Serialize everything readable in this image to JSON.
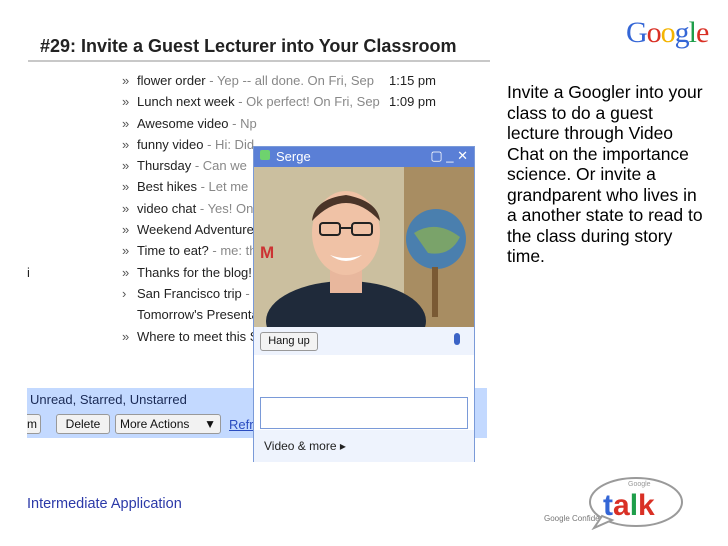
{
  "slide": {
    "title": "#29: Invite a Guest Lecturer into Your Classroom",
    "description": "Invite a Googler into your class to do a guest lecture through Video Chat on the importance science. Or invite a grandparent who lives in a another state to read to the class during story time.",
    "footer_label": "Intermediate Application",
    "confidential": "Google Confidential",
    "brand": {
      "letters": [
        "G",
        "o",
        "o",
        "g",
        "l",
        "e"
      ],
      "colors": [
        "#3466d6",
        "#d93025",
        "#f4b400",
        "#3466d6",
        "#1e9e4a",
        "#d93025"
      ]
    },
    "talk_logo": {
      "small_text": "Google",
      "word": "talk",
      "colors": [
        "#3466d6",
        "#d93025",
        "#1e9e4a",
        "#d93025"
      ]
    }
  },
  "mail": {
    "rows": [
      {
        "label": "",
        "chevron": "»",
        "subject": "flower order",
        "snippet": " - Yep -- all done. On Fri, Sep",
        "time": "1:15 pm"
      },
      {
        "label": "",
        "chevron": "»",
        "subject": "Lunch next week",
        "snippet": " - Ok perfect! On Fri, Sep",
        "time": "1:09 pm"
      },
      {
        "label": "",
        "chevron": "»",
        "subject": "Awesome video",
        "snippet": " - Np",
        "time": ""
      },
      {
        "label": "",
        "chevron": "»",
        "subject": "funny video",
        "snippet": " - Hi: Did",
        "time": ""
      },
      {
        "label": "",
        "chevron": "»",
        "subject": "Thursday",
        "snippet": " - Can we",
        "time": ""
      },
      {
        "label": "",
        "chevron": "»",
        "subject": "Best hikes",
        "snippet": " - Let me",
        "time": ""
      },
      {
        "label": "",
        "chevron": "»",
        "subject": "video chat",
        "snippet": " - Yes! On",
        "time": ""
      },
      {
        "label": "",
        "chevron": "»",
        "subject": "Weekend Adventure",
        "snippet": "",
        "time": ""
      },
      {
        "label": "",
        "chevron": "»",
        "subject": "Time to eat?",
        "snippet": " - me: th",
        "time": ""
      },
      {
        "label": "i",
        "chevron": "»",
        "subject": "Thanks for the blog!",
        "snippet": "",
        "time": ""
      },
      {
        "label": "",
        "chevron": "›",
        "subject": "San Francisco trip",
        "snippet": " -",
        "time": ""
      },
      {
        "label": "",
        "chevron": "",
        "subject": "Tomorrow's Presentat",
        "snippet": "",
        "time": ""
      },
      {
        "label": "",
        "chevron": "»",
        "subject": "Where to meet this S",
        "snippet": "",
        "time": ""
      }
    ],
    "labels_bar": "Unread, Starred, Unstarred",
    "actions": {
      "archive_fragment": "m",
      "delete": "Delete",
      "more_actions": "More Actions",
      "more_arrow": "▼",
      "refresh_fragment": "Refr"
    }
  },
  "chat": {
    "contact": "Serge",
    "controls": "▢ _ ✕",
    "gmail_mark": "M",
    "hangup": "Hang up",
    "video_more": "Video & more ▸"
  }
}
